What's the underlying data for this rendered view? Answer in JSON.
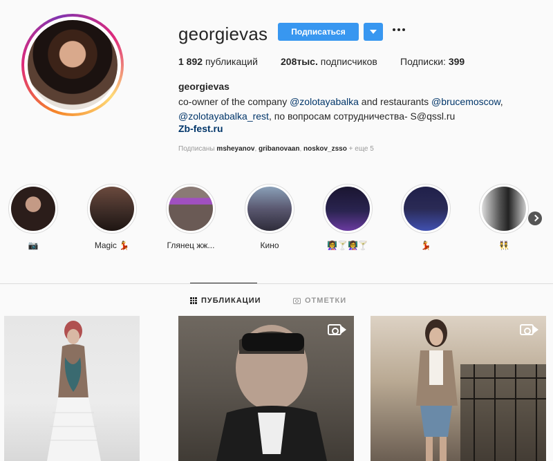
{
  "profile": {
    "username": "georgievas",
    "follow_label": "Подписаться",
    "stats": {
      "posts_count": "1 892",
      "posts_label": "публикаций",
      "followers_count": "208тыс.",
      "followers_label": "подписчиков",
      "following_label": "Подписки:",
      "following_count": "399"
    },
    "full_name": "georgievas",
    "bio": {
      "p1": "co-owner of the company ",
      "m1": "@zolotayabalka",
      "p2": " and restaurants ",
      "m2": "@brucemoscow",
      "p3": ",",
      "m3": "@zolotayabalka_rest",
      "p4": ", по вопросам сотрудничества- S@qssl.ru"
    },
    "link": "Zb-fest.ru",
    "followed_by": {
      "prefix": "Подписаны",
      "users": [
        "msheyanov",
        "gribanovaan",
        "noskov_zsso"
      ],
      "suffix": "+ еще 5"
    }
  },
  "stories": [
    {
      "label": "📷",
      "color": "#2b1d1a"
    },
    {
      "label": "Magic 💃",
      "color": "#3a2a25"
    },
    {
      "label": "Глянец жж...",
      "color": "#6a5a55"
    },
    {
      "label": "Кино",
      "color": "#5a5870"
    },
    {
      "label": "👩‍🏫🍸👩‍🏫🍸",
      "color": "#2a2450"
    },
    {
      "label": "💃",
      "color": "#2a2a55"
    },
    {
      "label": "👯",
      "color": "#555555"
    }
  ],
  "tabs": {
    "posts": "ПУБЛИКАЦИИ",
    "tagged": "ОТМЕТКИ"
  },
  "colors": {
    "accent": "#3897f0",
    "link": "#003569",
    "background": "#fafafa"
  },
  "icons": {
    "more": "more-options-icon",
    "grid": "grid-icon",
    "tag": "tag-icon",
    "video": "video-icon",
    "next": "chevron-right-icon"
  }
}
